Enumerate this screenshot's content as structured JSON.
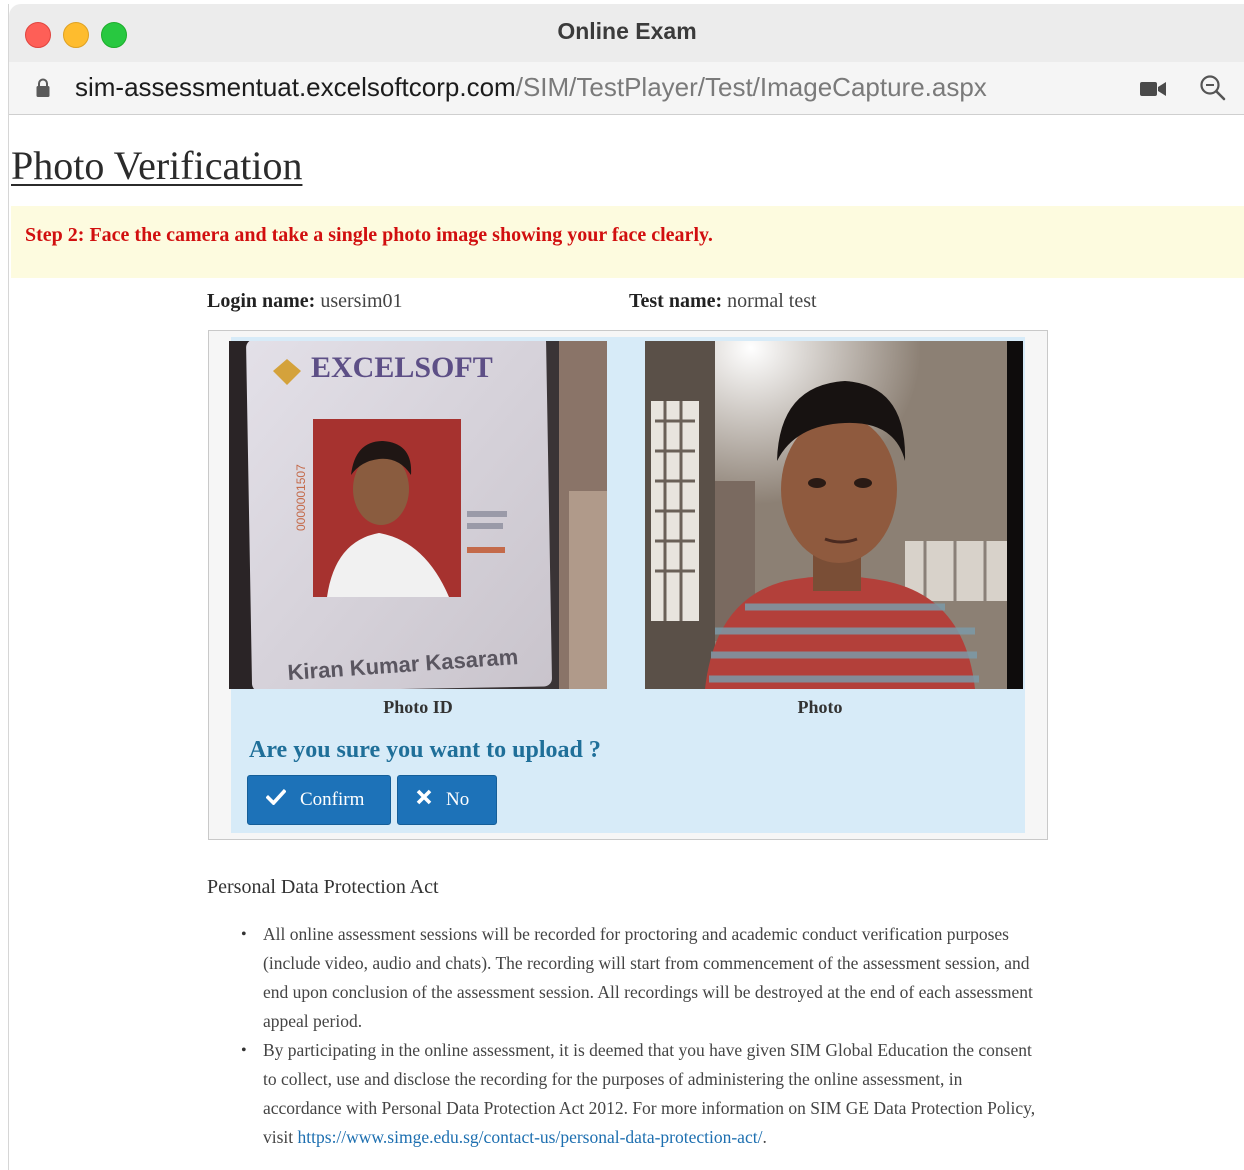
{
  "window": {
    "title": "Online Exam"
  },
  "address_bar": {
    "host": "sim-assessmentuat.excelsoftcorp.com",
    "path": "/SIM/TestPlayer/Test/ImageCapture.aspx"
  },
  "icons": {
    "lock": "lock-icon",
    "camera": "camera-icon",
    "zoom": "zoom-icon",
    "check": "check-icon",
    "close": "close-icon"
  },
  "page": {
    "title": "Photo Verification",
    "step_instruction": "Step 2: Face the camera and take a single photo image showing your face clearly.",
    "login_label": "Login name:",
    "login_value": "usersim01",
    "test_label": "Test name:",
    "test_value": "normal test"
  },
  "capture": {
    "photo_id_caption": "Photo ID",
    "photo_caption": "Photo",
    "id_card_name": "Kiran Kumar Kasaram",
    "id_card_brand": "EXCELSOFT",
    "question": "Are you sure you want to upload ?",
    "confirm_label": "Confirm",
    "no_label": "No"
  },
  "pdpa": {
    "title": "Personal Data Protection Act",
    "item1": "All online assessment sessions will be recorded for proctoring and academic conduct verification purposes (include video, audio and chats). The recording will start from commencement of the assessment session, and end upon conclusion of the assessment session. All recordings will be destroyed at the end of each assessment appeal period.",
    "item2_text": "By participating in the online assessment, it is deemed that you have given SIM Global Education the consent to collect, use and disclose the recording for the purposes of administering the online assessment, in accordance with Personal Data Protection Act 2012. For more information on SIM GE Data Protection Policy, visit ",
    "item2_link": "https://www.simge.edu.sg/contact-us/personal-data-protection-act/",
    "item2_end": "."
  },
  "colors": {
    "step_text": "#d10f0f",
    "banner_bg": "#fdfbdf",
    "panel_bg": "#d7ebf8",
    "question": "#1f6f99",
    "button": "#1d72b8",
    "link": "#1d6fb0"
  }
}
